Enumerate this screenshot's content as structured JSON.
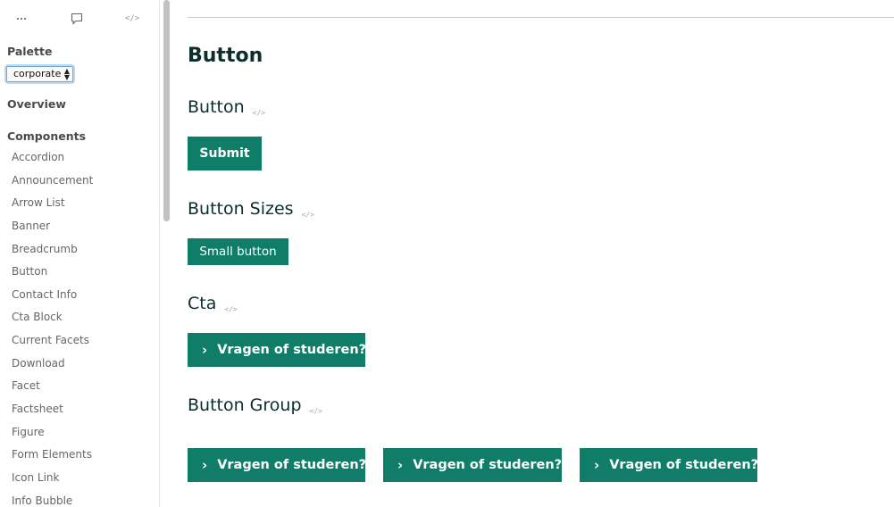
{
  "sidebar": {
    "toolbar": {
      "menu_icon": "more-dots-icon",
      "comment_icon": "comment-icon",
      "code_icon": "code-icon",
      "code_glyph": "</>"
    },
    "palette_label": "Palette",
    "palette_value": "corporate",
    "overview_label": "Overview",
    "components_label": "Components",
    "items": [
      "Accordion",
      "Announcement",
      "Arrow List",
      "Banner",
      "Breadcrumb",
      "Button",
      "Contact Info",
      "Cta Block",
      "Current Facets",
      "Download",
      "Facet",
      "Factsheet",
      "Figure",
      "Form Elements",
      "Icon Link",
      "Info Bubble"
    ]
  },
  "main": {
    "page_title": "Button",
    "code_glyph": "</>",
    "sections": {
      "button": {
        "heading": "Button",
        "button_label": "Submit"
      },
      "button_sizes": {
        "heading": "Button Sizes",
        "button_label": "Small button"
      },
      "cta": {
        "heading": "Cta",
        "button_label": "Vragen of studeren?"
      },
      "button_group": {
        "heading": "Button Group",
        "buttons": [
          "Vragen of studeren?",
          "Vragen of studeren?",
          "Vragen of studeren?"
        ]
      }
    },
    "chevron": "›"
  },
  "colors": {
    "accent": "#0f7d68",
    "heading": "#0b2e2b"
  }
}
